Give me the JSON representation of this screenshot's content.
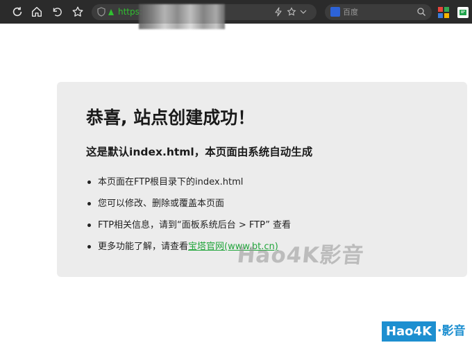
{
  "browser": {
    "url_text": "https:",
    "search_placeholder": "百度"
  },
  "page": {
    "title": "恭喜, 站点创建成功！",
    "subtitle": "这是默认index.html，本页面由系统自动生成",
    "items": [
      "本页面在FTP根目录下的index.html",
      "您可以修改、删除或覆盖本页面",
      "FTP相关信息，请到“面板系统后台 > FTP” 查看"
    ],
    "last_item_prefix": "更多功能了解，请查看",
    "last_item_link": "宝塔官网(www.bt.cn)"
  },
  "watermarks": {
    "center_text": "Hao4K影音",
    "corner_box": "Hao4K",
    "corner_rest": "·影音"
  },
  "colors": {
    "toolbar_bg": "#2b2b2b",
    "link_green": "#20a53a",
    "card_bg": "#ececec",
    "watermark_blue": "#1d8fd0"
  },
  "icons": [
    "reload-icon",
    "home-icon",
    "undo-icon",
    "star-icon",
    "shield-icon",
    "lock-icon",
    "bolt-icon",
    "chevron-down-icon",
    "baidu-paw-icon",
    "search-icon",
    "extension-grid-icon",
    "extension-flag-icon"
  ]
}
